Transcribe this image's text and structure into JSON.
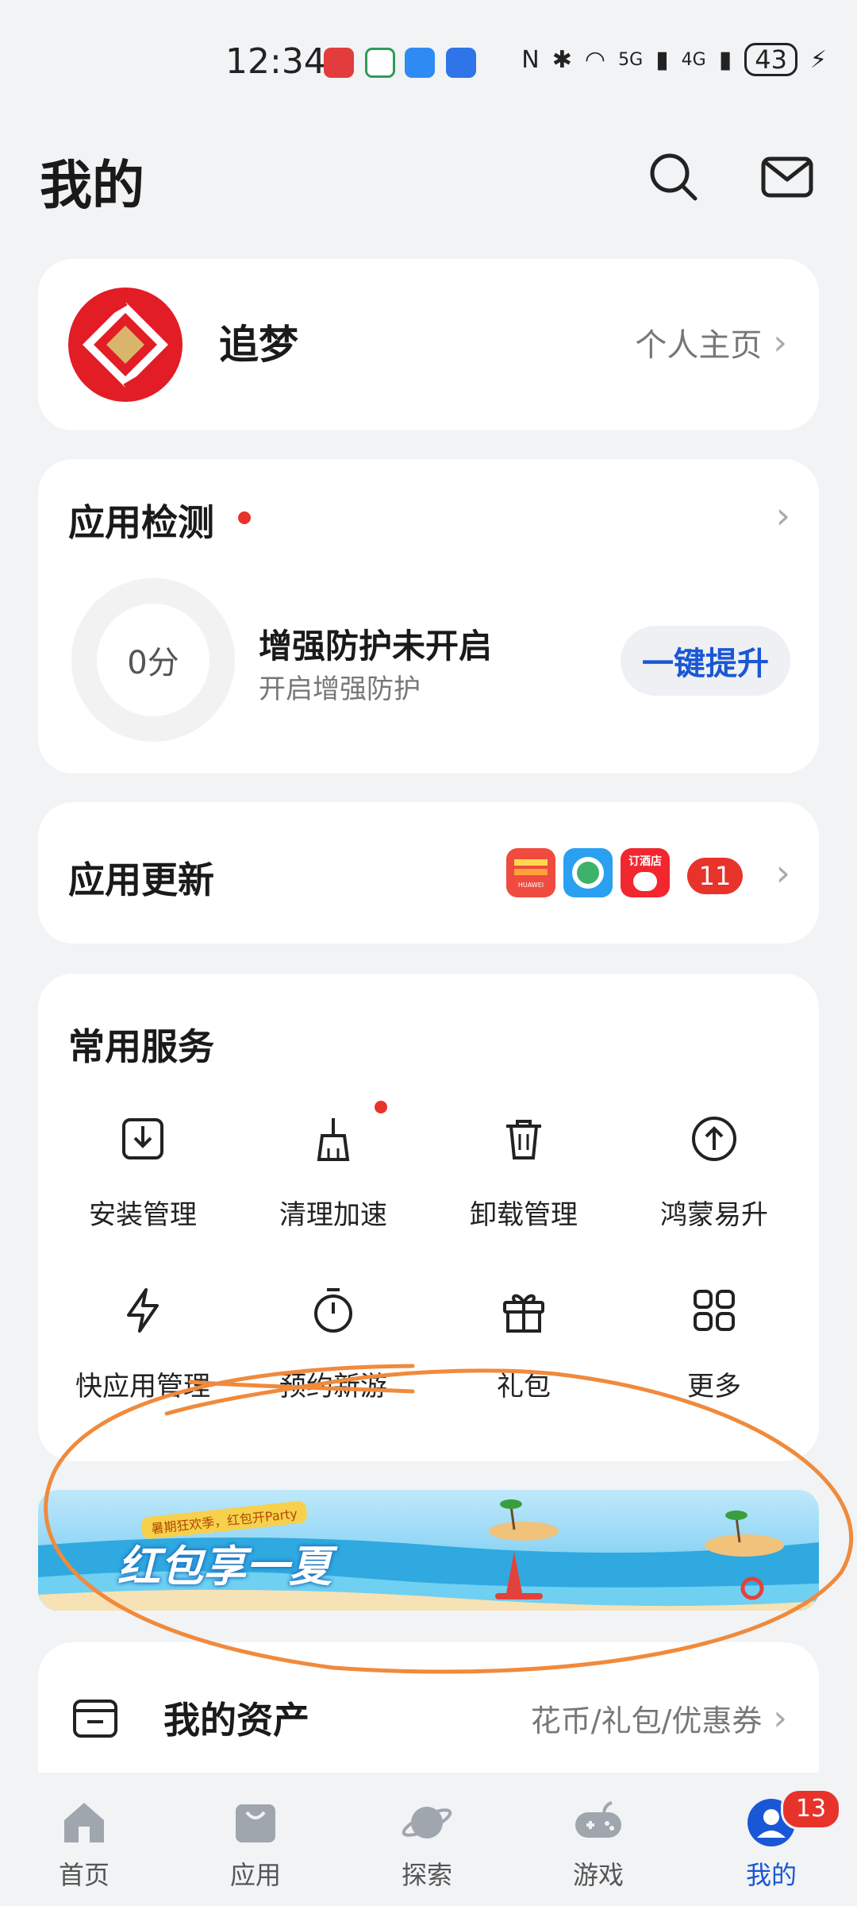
{
  "status_bar": {
    "time": "12:34",
    "network_5g": "5G",
    "network_4g": "4G",
    "battery": "43"
  },
  "header": {
    "title": "我的"
  },
  "profile": {
    "name": "追梦",
    "home_link": "个人主页"
  },
  "app_check": {
    "title": "应用检测",
    "score": "0分",
    "protection_title": "增强防护未开启",
    "protection_subtitle": "开启增强防护",
    "action_label": "一键提升"
  },
  "app_update": {
    "title": "应用更新",
    "icon_label": "HUAWEI",
    "hotel_label": "订酒店",
    "count": "11"
  },
  "services": {
    "title": "常用服务",
    "items": [
      {
        "label": "安装管理",
        "icon": "install-icon"
      },
      {
        "label": "清理加速",
        "icon": "broom-icon"
      },
      {
        "label": "卸载管理",
        "icon": "trash-icon"
      },
      {
        "label": "鸿蒙易升",
        "icon": "upgrade-arrow-icon"
      },
      {
        "label": "快应用管理",
        "icon": "quick-app-icon"
      },
      {
        "label": "预约新游",
        "icon": "timer-icon"
      },
      {
        "label": "礼包",
        "icon": "gift-icon"
      },
      {
        "label": "更多",
        "icon": "grid-icon"
      }
    ]
  },
  "banner": {
    "title": "红包享一夏",
    "subtitle": "暑期狂欢季，红包开Party"
  },
  "assets": {
    "title": "我的资产",
    "subtitle": "花币/礼包/优惠券"
  },
  "bottom_nav": {
    "items": [
      {
        "label": "首页",
        "icon": "home-icon"
      },
      {
        "label": "应用",
        "icon": "shopping-bag-icon"
      },
      {
        "label": "探索",
        "icon": "planet-icon"
      },
      {
        "label": "游戏",
        "icon": "gamepad-icon"
      },
      {
        "label": "我的",
        "icon": "person-icon",
        "active": true
      }
    ],
    "badge_count": "13"
  },
  "colors": {
    "accent": "#1a57d6",
    "badge": "#e8332b",
    "background": "#f1f3f5",
    "annotation": "#f08a3c"
  }
}
